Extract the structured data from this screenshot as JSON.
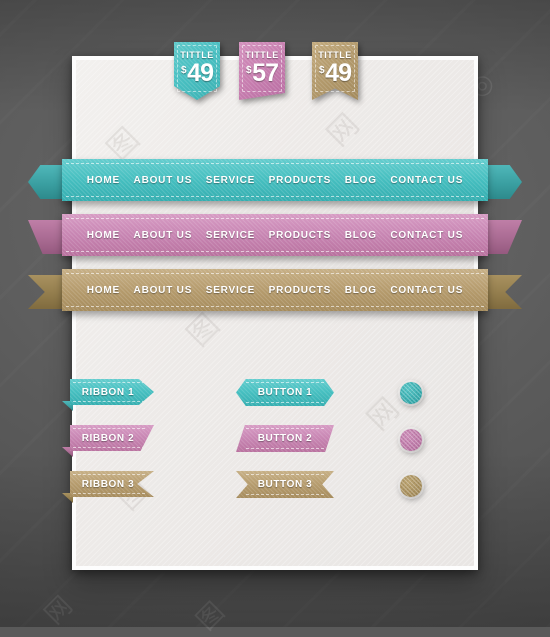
{
  "palette": {
    "teal": "#46bfc0",
    "pink": "#c886b3",
    "gold": "#b69c6e",
    "backdrop": "#5a5a5a",
    "canvas": "#eeebe9",
    "label_text": "#ffffff"
  },
  "canvas": {
    "name": "ui-kit-canvas"
  },
  "price_tags": [
    {
      "title": "TITTLE",
      "currency": "$",
      "amount": "49",
      "color": "teal",
      "shape": "pointed"
    },
    {
      "title": "TITTLE",
      "currency": "$",
      "amount": "57",
      "color": "pink",
      "shape": "slanted"
    },
    {
      "title": "TITTLE",
      "currency": "$",
      "amount": "49",
      "color": "gold",
      "shape": "swallowtail"
    }
  ],
  "nav_bars": [
    {
      "color": "teal",
      "tail": "hexagon",
      "items": [
        "HOME",
        "ABOUT US",
        "SERVICE",
        "PRODUCTS",
        "BLOG",
        "CONTACT US"
      ]
    },
    {
      "color": "pink",
      "tail": "triangle",
      "items": [
        "HOME",
        "ABOUT US",
        "SERVICE",
        "PRODUCTS",
        "BLOG",
        "CONTACT US"
      ]
    },
    {
      "color": "gold",
      "tail": "forked",
      "items": [
        "HOME",
        "ABOUT US",
        "SERVICE",
        "PRODUCTS",
        "BLOG",
        "CONTACT US"
      ]
    }
  ],
  "ribbons": [
    {
      "label": "RIBBON 1",
      "color": "teal",
      "shape": "arrow"
    },
    {
      "label": "RIBBON 2",
      "color": "pink",
      "shape": "slant"
    },
    {
      "label": "RIBBON 3",
      "color": "gold",
      "shape": "swallowtail"
    }
  ],
  "buttons": [
    {
      "label": "BUTTON 1",
      "color": "teal",
      "shape": "hexagon"
    },
    {
      "label": "BUTTON 2",
      "color": "pink",
      "shape": "parallelogram"
    },
    {
      "label": "BUTTON 3",
      "color": "gold",
      "shape": "double-swallowtail"
    }
  ],
  "circles": [
    {
      "color": "teal"
    },
    {
      "color": "pink"
    },
    {
      "color": "gold"
    }
  ]
}
